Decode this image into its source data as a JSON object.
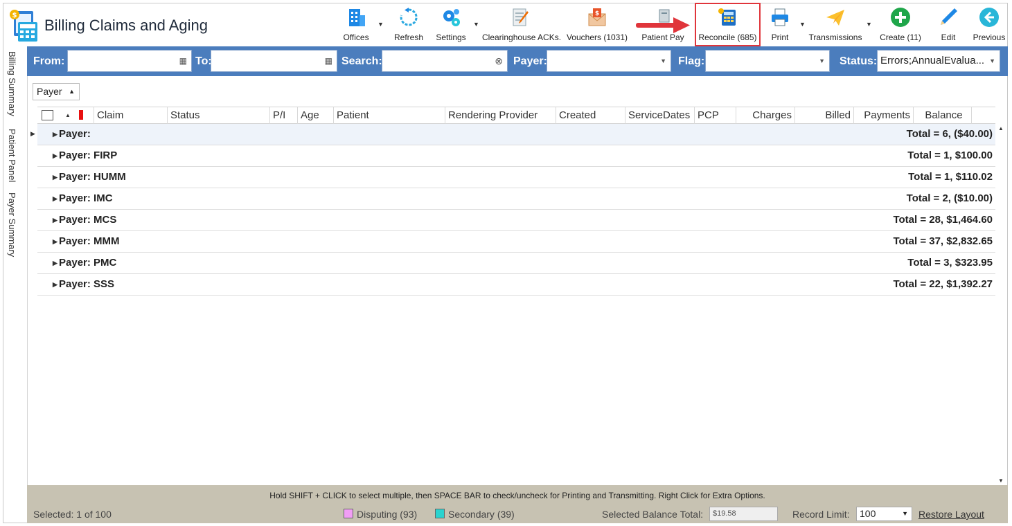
{
  "app": {
    "title": "Billing Claims and Aging"
  },
  "toolbar": {
    "offices": "Offices",
    "refresh": "Refresh",
    "settings": "Settings",
    "clearinghouse": "Clearinghouse ACKs.",
    "vouchers": "Vouchers (1031)",
    "patient_pay": "Patient Pay",
    "reconcile": "Reconcile (685)",
    "print": "Print",
    "transmissions": "Transmissions",
    "create": "Create (11)",
    "edit": "Edit",
    "previous": "Previous"
  },
  "filters": {
    "from_label": "From:",
    "from_value": "",
    "to_label": "To:",
    "to_value": "",
    "search_label": "Search:",
    "search_value": "",
    "payer_label": "Payer:",
    "payer_value": "",
    "flag_label": "Flag:",
    "flag_value": "",
    "status_label": "Status:",
    "status_value": "Errors;AnnualEvalua..."
  },
  "sidetabs": [
    "Billing Summary",
    "Patient Panel",
    "Payer Summary"
  ],
  "groupby": {
    "label": "Payer"
  },
  "columns": [
    "Claim",
    "Status",
    "P/I",
    "Age",
    "Patient",
    "Rendering Provider",
    "Created",
    "ServiceDates",
    "PCP",
    "Charges",
    "Billed",
    "Payments",
    "Balance"
  ],
  "groups": [
    {
      "label": "Payer:",
      "total": "Total = 6,  ($40.00)"
    },
    {
      "label": "Payer: FIRP",
      "total": "Total = 1,  $100.00"
    },
    {
      "label": "Payer: HUMM",
      "total": "Total = 1,  $110.02"
    },
    {
      "label": "Payer: IMC",
      "total": "Total = 2,  ($10.00)"
    },
    {
      "label": "Payer: MCS",
      "total": "Total = 28,  $1,464.60"
    },
    {
      "label": "Payer: MMM",
      "total": "Total = 37,  $2,832.65"
    },
    {
      "label": "Payer: PMC",
      "total": "Total = 3,  $323.95"
    },
    {
      "label": "Payer: SSS",
      "total": "Total = 22,  $1,392.27"
    }
  ],
  "footer": {
    "hint": "Hold SHIFT + CLICK to select multiple, then SPACE BAR to check/uncheck for Printing and Transmitting. Right Click for Extra Options.",
    "selected": "Selected: 1 of 100",
    "disputing": "Disputing (93)",
    "secondary": "Secondary (39)",
    "balance_label": "Selected Balance Total:",
    "balance_value": "$19.58",
    "limit_label": "Record Limit:",
    "limit_value": "100",
    "restore": "Restore Layout"
  },
  "colors": {
    "filterbar": "#4b7dbd",
    "footer": "#c7c2b2",
    "highlight": "#e0353b",
    "disputing": "#f19ef5",
    "secondary": "#2ad3cf"
  }
}
